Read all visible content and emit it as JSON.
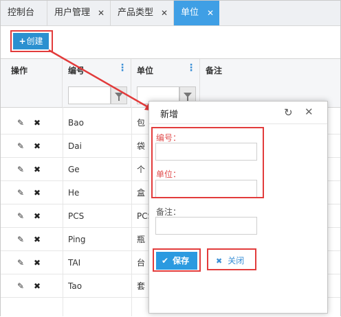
{
  "tabs": [
    {
      "label": "控制台",
      "closable": false,
      "active": false
    },
    {
      "label": "用户管理",
      "closable": true,
      "active": false
    },
    {
      "label": "产品类型",
      "closable": true,
      "active": false
    },
    {
      "label": "单位",
      "closable": true,
      "active": true
    }
  ],
  "toolbar": {
    "create_label": "创建",
    "create_icon": "plus-icon"
  },
  "grid": {
    "columns": [
      "操作",
      "编号",
      "单位",
      "备注"
    ],
    "rows": [
      {
        "code": "Bao",
        "unit": "包"
      },
      {
        "code": "Dai",
        "unit": "袋"
      },
      {
        "code": "Ge",
        "unit": "个"
      },
      {
        "code": "He",
        "unit": "盒"
      },
      {
        "code": "PCS",
        "unit": "PCS"
      },
      {
        "code": "Ping",
        "unit": "瓶"
      },
      {
        "code": "TAI",
        "unit": "台"
      },
      {
        "code": "Tao",
        "unit": "套"
      }
    ]
  },
  "dialog": {
    "title": "新增",
    "fields": [
      {
        "label": "编号：",
        "value": "",
        "required": true
      },
      {
        "label": "单位：",
        "value": "",
        "required": true
      },
      {
        "label": "备注：",
        "value": "",
        "required": false
      }
    ],
    "save_label": "保存",
    "close_label": "关闭"
  },
  "colors": {
    "accent": "#3f9fe5",
    "highlight": "#e23b3b",
    "required_label": "#e04b4b",
    "button_primary": "#2b90d0"
  }
}
